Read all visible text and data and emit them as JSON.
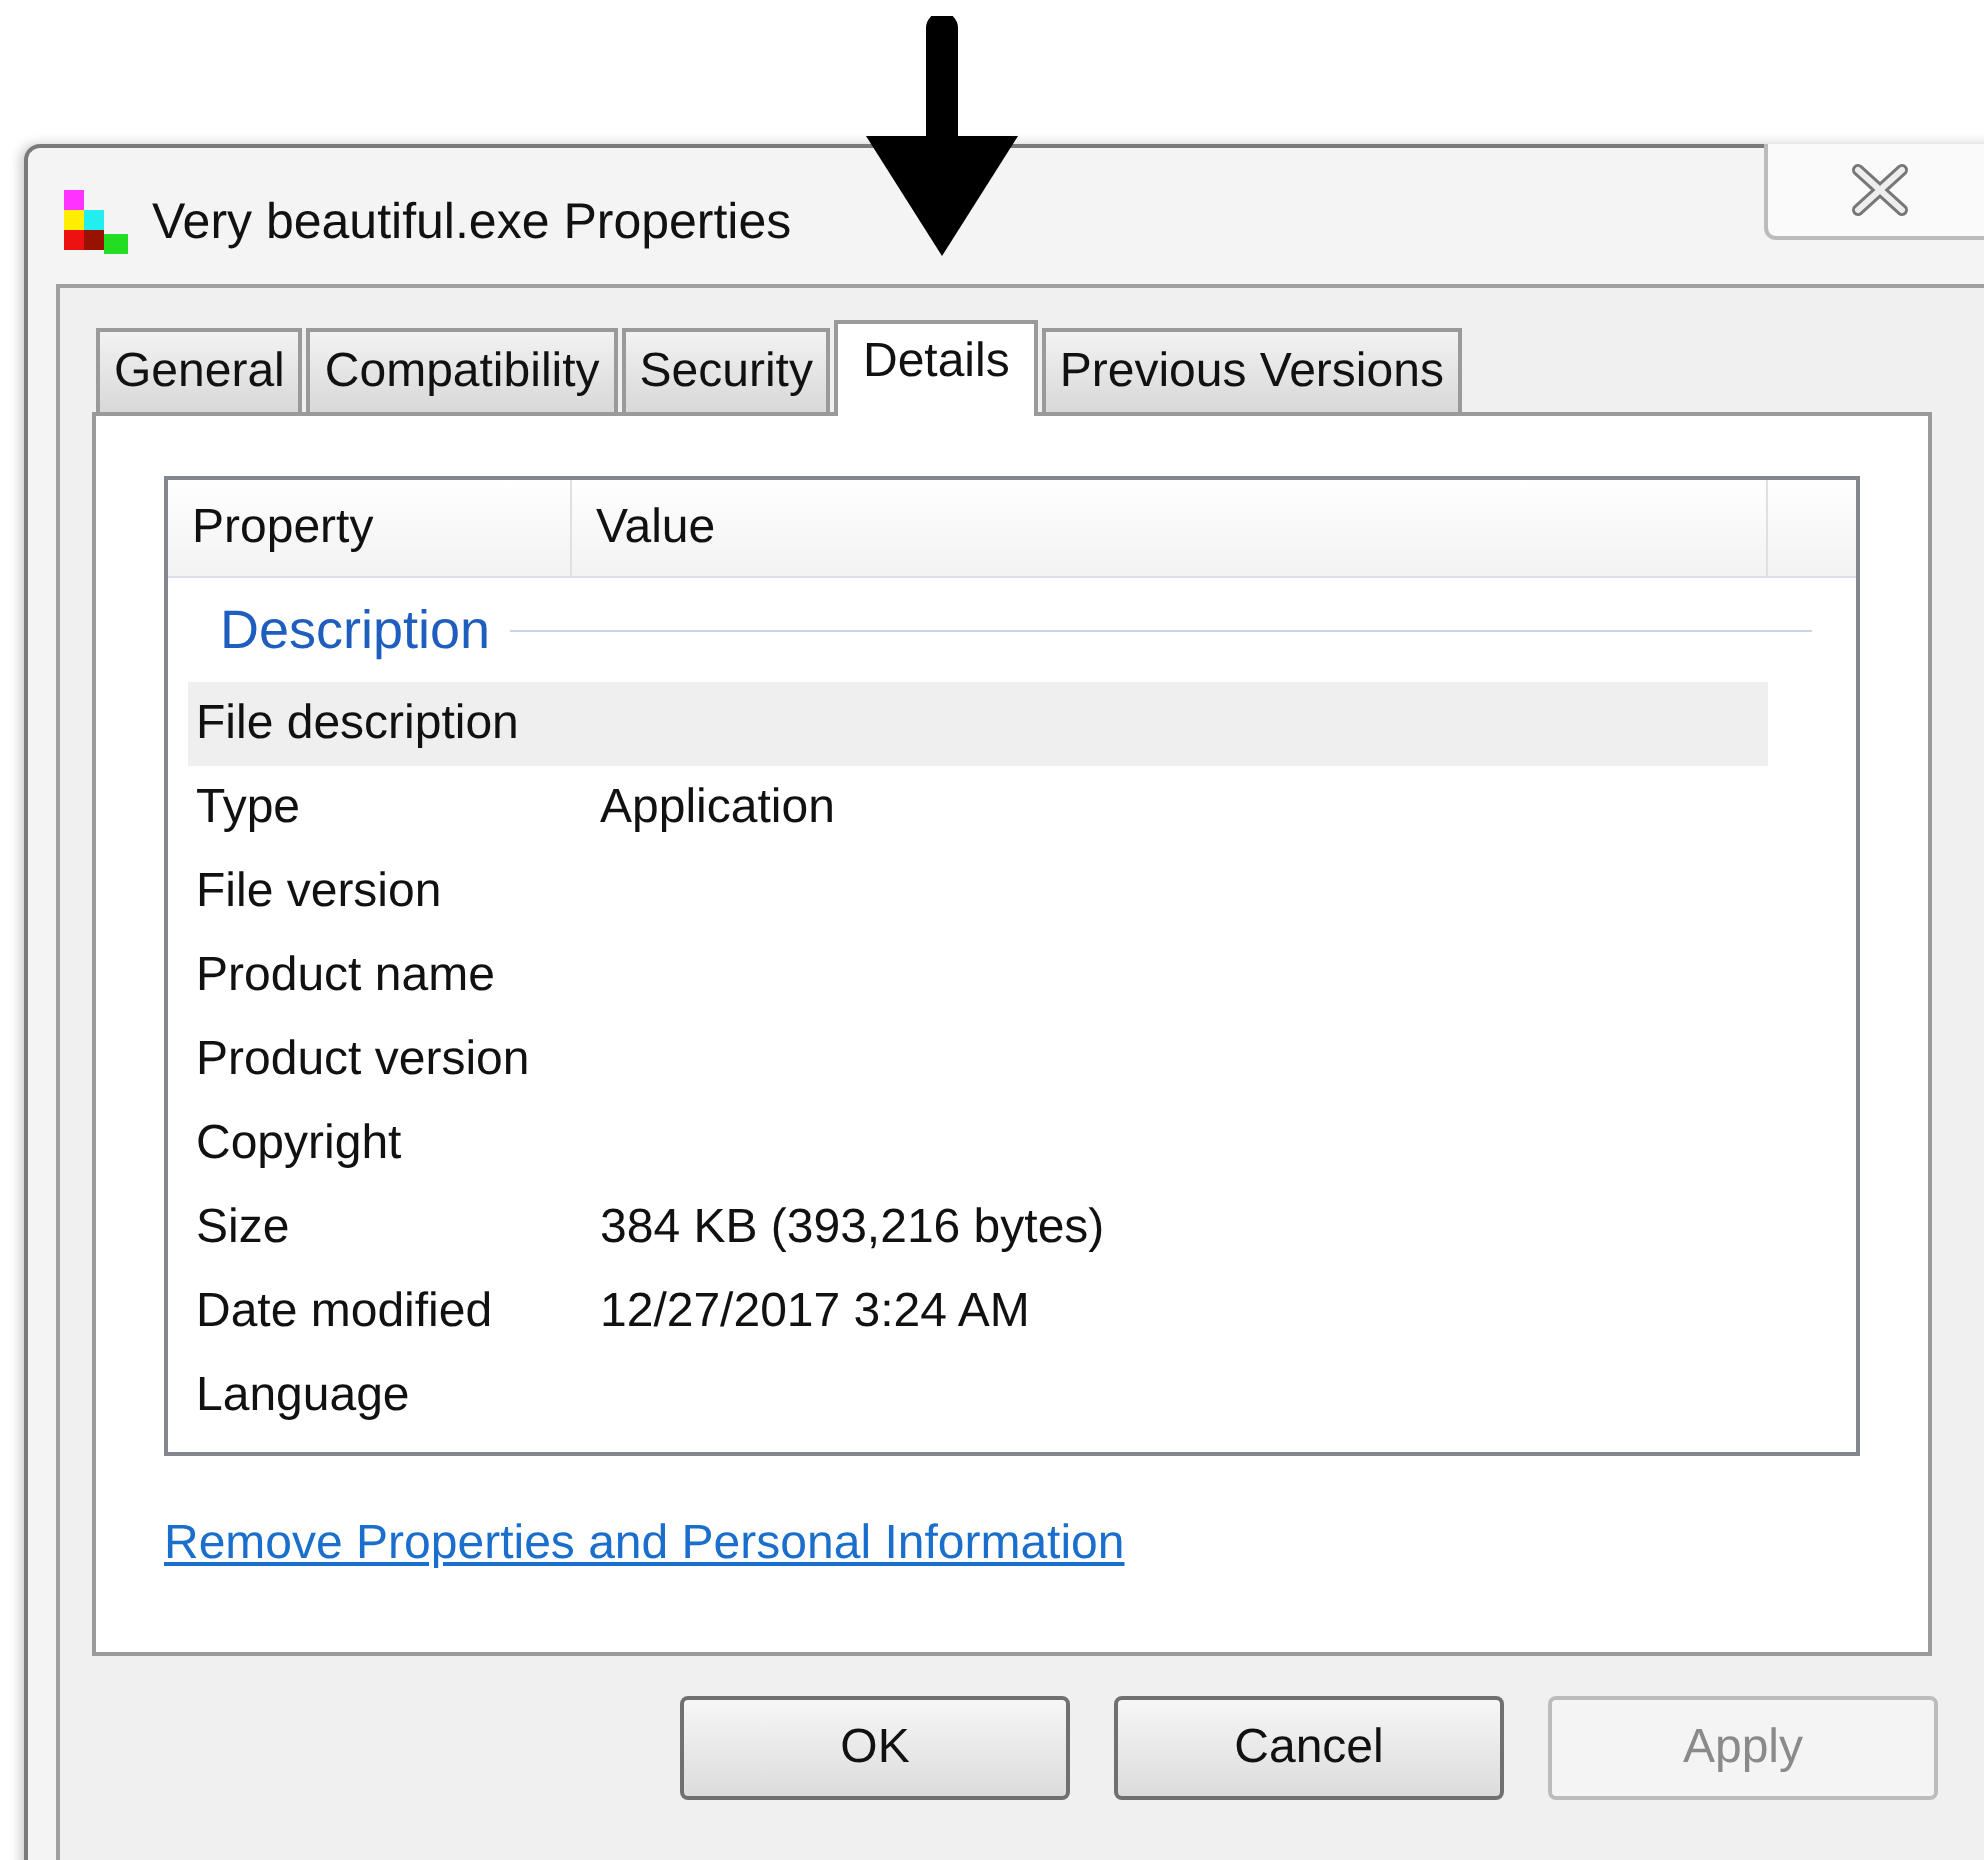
{
  "window": {
    "title": "Very beautiful.exe Properties"
  },
  "tabs": [
    {
      "label": "General",
      "selected": false
    },
    {
      "label": "Compatibility",
      "selected": false
    },
    {
      "label": "Security",
      "selected": false
    },
    {
      "label": "Details",
      "selected": true
    },
    {
      "label": "Previous Versions",
      "selected": false
    }
  ],
  "table": {
    "columns": [
      "Property",
      "Value"
    ],
    "group": "Description",
    "rows": [
      {
        "property": "File description",
        "value": "",
        "selected": true
      },
      {
        "property": "Type",
        "value": "Application",
        "selected": false
      },
      {
        "property": "File version",
        "value": "",
        "selected": false
      },
      {
        "property": "Product name",
        "value": "",
        "selected": false
      },
      {
        "property": "Product version",
        "value": "",
        "selected": false
      },
      {
        "property": "Copyright",
        "value": "",
        "selected": false
      },
      {
        "property": "Size",
        "value": "384 KB (393,216 bytes)",
        "selected": false
      },
      {
        "property": "Date modified",
        "value": "12/27/2017 3:24 AM",
        "selected": false
      },
      {
        "property": "Language",
        "value": "",
        "selected": false
      }
    ]
  },
  "link": "Remove Properties and Personal Information",
  "buttons": [
    {
      "label": "OK",
      "disabled": false
    },
    {
      "label": "Cancel",
      "disabled": false
    },
    {
      "label": "Apply",
      "disabled": true
    }
  ]
}
